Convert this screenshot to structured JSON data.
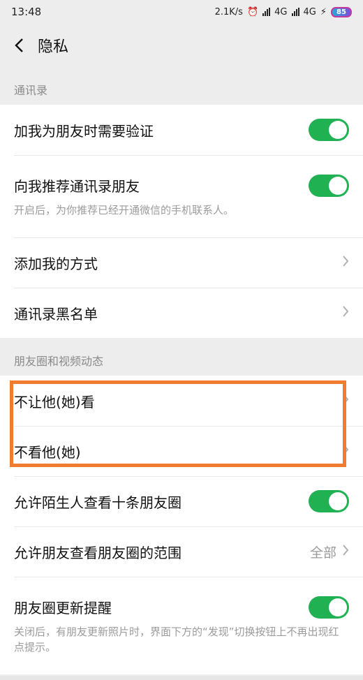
{
  "status_bar": {
    "time": "13:48",
    "net_speed": "2.1K/s",
    "carrier1": "4G",
    "carrier2": "4G",
    "battery": "85"
  },
  "nav": {
    "title": "隐私"
  },
  "sections": {
    "contacts": {
      "header": "通讯录",
      "require_verify": {
        "label": "加我为朋友时需要验证",
        "on": true
      },
      "recommend": {
        "label": "向我推荐通讯录朋友",
        "desc": "开启后，为你推荐已经开通微信的手机联系人。",
        "on": true
      },
      "add_methods": {
        "label": "添加我的方式"
      },
      "blacklist": {
        "label": "通讯录黑名单"
      }
    },
    "moments": {
      "header": "朋友圈和视频动态",
      "hide_my_posts": {
        "label": "不让他(她)看"
      },
      "hide_their_posts": {
        "label": "不看他(她)"
      },
      "allow_strangers": {
        "label": "允许陌生人查看十条朋友圈",
        "on": true
      },
      "visible_range": {
        "label": "允许朋友查看朋友圈的范围",
        "value": "全部"
      },
      "update_reminder": {
        "label": "朋友圈更新提醒",
        "desc": "关闭后，有朋友更新照片时，界面下方的“发现”切换按钮上不再出现红点提示。",
        "on": true
      }
    }
  },
  "colors": {
    "toggle_on": "#20b153",
    "highlight": "#f07c30"
  }
}
